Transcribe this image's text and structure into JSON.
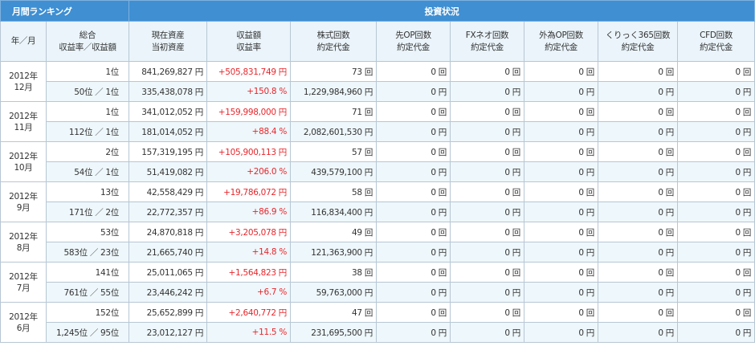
{
  "header": {
    "ranking_title": "月間ランキング",
    "investment_title": "投資状況",
    "columns": [
      {
        "line1": "年／月",
        "line2": ""
      },
      {
        "line1": "総合",
        "line2": "収益率／収益額"
      },
      {
        "line1": "現在資産",
        "line2": "当初資産"
      },
      {
        "line1": "収益額",
        "line2": "収益率"
      },
      {
        "line1": "株式回数",
        "line2": "約定代金"
      },
      {
        "line1": "先OP回数",
        "line2": "約定代金"
      },
      {
        "line1": "FXネオ回数",
        "line2": "約定代金"
      },
      {
        "line1": "外為OP回数",
        "line2": "約定代金"
      },
      {
        "line1": "くりっく365回数",
        "line2": "約定代金"
      },
      {
        "line1": "CFD回数",
        "line2": "約定代金"
      }
    ]
  },
  "rows": [
    {
      "year": "2012年",
      "month": "12月",
      "r1": [
        "1位",
        "841,269,827 円",
        "+505,831,749 円",
        "73 回",
        "0 回",
        "0 回",
        "0 回",
        "0 回",
        "0 回"
      ],
      "r2": [
        "50位 ／ 1位",
        "335,438,078 円",
        "+150.8 %",
        "1,229,984,960 円",
        "0 円",
        "0 円",
        "0 円",
        "0 円",
        "0 円"
      ]
    },
    {
      "year": "2012年",
      "month": "11月",
      "r1": [
        "1位",
        "341,012,052 円",
        "+159,998,000 円",
        "71 回",
        "0 回",
        "0 回",
        "0 回",
        "0 回",
        "0 回"
      ],
      "r2": [
        "112位 ／ 1位",
        "181,014,052 円",
        "+88.4 %",
        "2,082,601,530 円",
        "0 円",
        "0 円",
        "0 円",
        "0 円",
        "0 円"
      ]
    },
    {
      "year": "2012年",
      "month": "10月",
      "r1": [
        "2位",
        "157,319,195 円",
        "+105,900,113 円",
        "57 回",
        "0 回",
        "0 回",
        "0 回",
        "0 回",
        "0 回"
      ],
      "r2": [
        "54位 ／ 1位",
        "51,419,082 円",
        "+206.0 %",
        "439,579,100 円",
        "0 円",
        "0 円",
        "0 円",
        "0 円",
        "0 円"
      ]
    },
    {
      "year": "2012年",
      "month": "9月",
      "r1": [
        "13位",
        "42,558,429 円",
        "+19,786,072 円",
        "58 回",
        "0 回",
        "0 回",
        "0 回",
        "0 回",
        "0 回"
      ],
      "r2": [
        "171位 ／ 2位",
        "22,772,357 円",
        "+86.9 %",
        "116,834,400 円",
        "0 円",
        "0 円",
        "0 円",
        "0 円",
        "0 円"
      ]
    },
    {
      "year": "2012年",
      "month": "8月",
      "r1": [
        "53位",
        "24,870,818 円",
        "+3,205,078 円",
        "49 回",
        "0 回",
        "0 回",
        "0 回",
        "0 回",
        "0 回"
      ],
      "r2": [
        "583位 ／ 23位",
        "21,665,740 円",
        "+14.8 %",
        "121,363,900 円",
        "0 円",
        "0 円",
        "0 円",
        "0 円",
        "0 円"
      ]
    },
    {
      "year": "2012年",
      "month": "7月",
      "r1": [
        "141位",
        "25,011,065 円",
        "+1,564,823 円",
        "38 回",
        "0 回",
        "0 回",
        "0 回",
        "0 回",
        "0 回"
      ],
      "r2": [
        "761位 ／ 55位",
        "23,446,242 円",
        "+6.7 %",
        "59,763,000 円",
        "0 円",
        "0 円",
        "0 円",
        "0 円",
        "0 円"
      ]
    },
    {
      "year": "2012年",
      "month": "6月",
      "r1": [
        "152位",
        "25,652,899 円",
        "+2,640,772 円",
        "47 回",
        "0 回",
        "0 回",
        "0 回",
        "0 回",
        "0 回"
      ],
      "r2": [
        "1,245位 ／ 95位",
        "23,012,127 円",
        "+11.5 %",
        "231,695,500 円",
        "0 円",
        "0 円",
        "0 円",
        "0 円",
        "0 円"
      ]
    }
  ],
  "colors": {
    "header_bg": "#3f8fd2",
    "subheader_bg": "#eaf4fa",
    "alt_row_bg": "#eef7fb",
    "border": "#b7c7d4",
    "profit_red": "#e8262b"
  }
}
